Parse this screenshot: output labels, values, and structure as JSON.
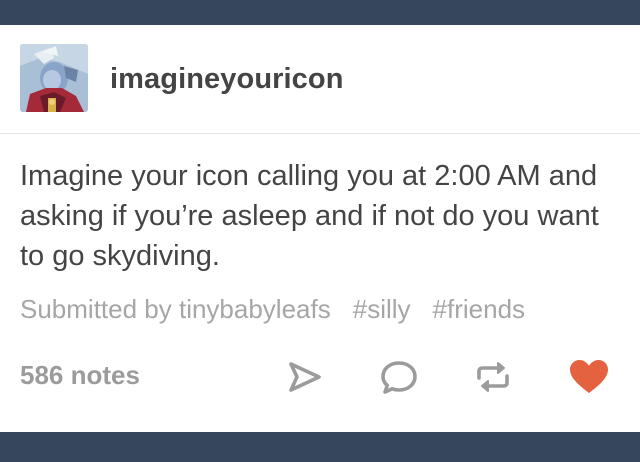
{
  "post": {
    "username": "imagineyouricon",
    "avatar_icon": "avatar-character-icon",
    "text": "Imagine your icon calling you at 2:00 AM and asking if you’re asleep and if not do you want to go skydiving.",
    "submitted_by": "Submitted by tinybabyleafs",
    "tags": [
      "#silly",
      "#friends"
    ],
    "notes": "586 notes"
  },
  "actions": {
    "share_icon": "share-icon",
    "reply_icon": "reply-icon",
    "reblog_icon": "reblog-icon",
    "like_icon": "heart-icon"
  },
  "colors": {
    "dashboard_bg": "#36465d",
    "card_bg": "#ffffff",
    "text": "#444444",
    "muted": "#a6a6a6",
    "icon": "#9b9b9b",
    "like": "#e4623f"
  }
}
